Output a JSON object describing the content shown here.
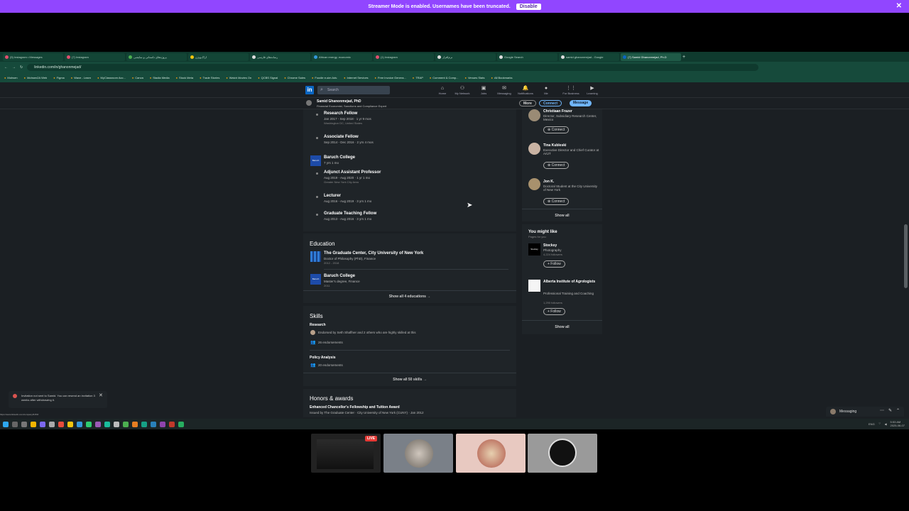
{
  "streamer_banner": {
    "message": "Streamer Mode is enabled. Usernames have been truncated.",
    "button": "Disable",
    "close": "✕"
  },
  "browser": {
    "tabs": [
      {
        "label": "(5) Instagram • Messages"
      },
      {
        "label": "(7) Instagram"
      },
      {
        "label": "پروژه‌های داستانی و نمایشی"
      },
      {
        "label": "اراک‌ویژن"
      },
      {
        "label": "رسانه‌های فارسی"
      },
      {
        "label": "African energy, economic"
      },
      {
        "label": "(1) Instagram"
      },
      {
        "label": "نرم‌افزار"
      },
      {
        "label": "Google Search"
      },
      {
        "label": "samid ghanonmejad - Google"
      },
      {
        "label": "(7) Samid Ghanonmejad, Ph.D"
      }
    ],
    "url": "linkedin.com/in/ghanonmejad/",
    "bookmarks": [
      "Mohsen",
      "Mohsen2A Web",
      "Figma",
      "Wave - Learn",
      "MyClassroom Acc...",
      "Canva",
      "Stadia Media",
      "Stock Meta",
      "Trade Stories",
      "Watch Movies On",
      "QCBS Signal",
      "Chrome Sales",
      "Foodie e-sim Adv.",
      "Internet Services",
      "Free Invoice Genera...",
      "TRAP",
      "Comment & Comp...",
      "Venues Stats",
      "All Bookmarks"
    ]
  },
  "linkedin": {
    "logo": "in",
    "search_placeholder": "Search",
    "nav": [
      {
        "label": "Home",
        "icon": "home-icon",
        "glyph": "⌂"
      },
      {
        "label": "My Network",
        "icon": "network-icon",
        "glyph": "⚇"
      },
      {
        "label": "Jobs",
        "icon": "jobs-icon",
        "glyph": "▣"
      },
      {
        "label": "Messaging",
        "icon": "messaging-icon",
        "glyph": "✉"
      },
      {
        "label": "Notifications",
        "icon": "bell-icon",
        "glyph": "🔔"
      },
      {
        "label": "Me",
        "icon": "me-icon",
        "glyph": "●"
      },
      {
        "label": "For Business",
        "icon": "grid-icon",
        "glyph": "⋮⋮"
      },
      {
        "label": "Learning",
        "icon": "learning-icon",
        "glyph": "▶"
      }
    ],
    "profile_bar": {
      "name": "Samid Ghanonmejad, PhD",
      "headline": "Financial Economist, Sanctions and Compliance Expert",
      "more": "More",
      "connect": "Connect",
      "message": "Message"
    },
    "experience": {
      "items": [
        {
          "title": "Research Fellow",
          "dates": "Jan 2017 - Sep 2018 · 1 yr 9 mos",
          "place": "Washington DC, United States"
        },
        {
          "title": "Associate Fellow",
          "dates": "Sep 2014 - Dec 2016 · 2 yrs 4 mos"
        }
      ],
      "company": {
        "name": "Baruch College",
        "duration": "7 yrs 1 mo",
        "logo": "Baruch"
      },
      "roles": [
        {
          "title": "Adjunct Assistant Professor",
          "dates": "Aug 2019 - Aug 2020 · 1 yr 1 mo",
          "place": "Greater New York City Area"
        },
        {
          "title": "Lecturer",
          "dates": "Aug 2016 - Aug 2019 · 3 yrs 1 mo"
        },
        {
          "title": "Graduate Teaching Fellow",
          "dates": "Aug 2013 - Aug 2016 · 3 yrs 1 mo"
        }
      ]
    },
    "education": {
      "title": "Education",
      "items": [
        {
          "school": "The Graduate Center, City University of New York",
          "degree": "Doctor of Philosophy (PhD), Finance",
          "years": "2012 - 2018"
        },
        {
          "school": "Baruch College",
          "degree": "Master's degree, Finance",
          "years": "2011",
          "logo": "Baruch"
        }
      ],
      "show_all": "Show all 4 educations →"
    },
    "skills": {
      "title": "Skills",
      "items": [
        {
          "name": "Research",
          "endorsed_by": "Endorsed by Seth Shaffner and 2 others who are highly skilled at this",
          "endorsements": "26 endorsements"
        },
        {
          "name": "Policy Analysis",
          "endorsements": "20 endorsements"
        }
      ],
      "show_all": "Show all 50 skills →"
    },
    "honors": {
      "title": "Honors & awards",
      "item_title": "Enhanced Chancellor's Fellowship and Tuition Award",
      "item_sub": "Issued by The Graduate Center · City University of New York (CUNY) · Jan 2012"
    },
    "sidebar_people": [
      {
        "name": "Christiaan Frazer",
        "headline": "Director, Subsidiary Research Center, Mexico"
      },
      {
        "name": "Tina Kubleski",
        "headline": "Executive Director and Chief Curator at ArtJT"
      },
      {
        "name": "Jon K.",
        "headline": "Doctoral Student at the City University of New York"
      }
    ],
    "connect_label": "Connect",
    "show_all": "Show all",
    "you_might_like": {
      "title": "You might like",
      "subtitle": "Pages for you",
      "pages": [
        {
          "name": "Stocksy",
          "desc": "Photography",
          "followers": "4,224 followers",
          "logo": "Stocksy"
        },
        {
          "name": "Alberta Institute of Agrologists",
          "desc": "Professional Training and Coaching",
          "followers": "1,290 followers"
        }
      ],
      "follow_label": "+ Follow",
      "show_all": "Show all"
    },
    "toast": {
      "text": "Invitation not sent to Samid. You can resend an invitation 3 weeks after withdrawing it."
    },
    "messaging": {
      "label": "Messaging"
    }
  },
  "status_url": "https://www.linkedin.com/company/6150/",
  "taskbar": {
    "tray_time": "5:53 AM",
    "tray_date": "2025-06-07",
    "lang": "ENG"
  },
  "stream": {
    "live_badge": "LIVE"
  },
  "colors": {
    "banner": "#9146ff",
    "linkedin_blue": "#0a66c2",
    "connect_pill": "#70b5f9"
  }
}
